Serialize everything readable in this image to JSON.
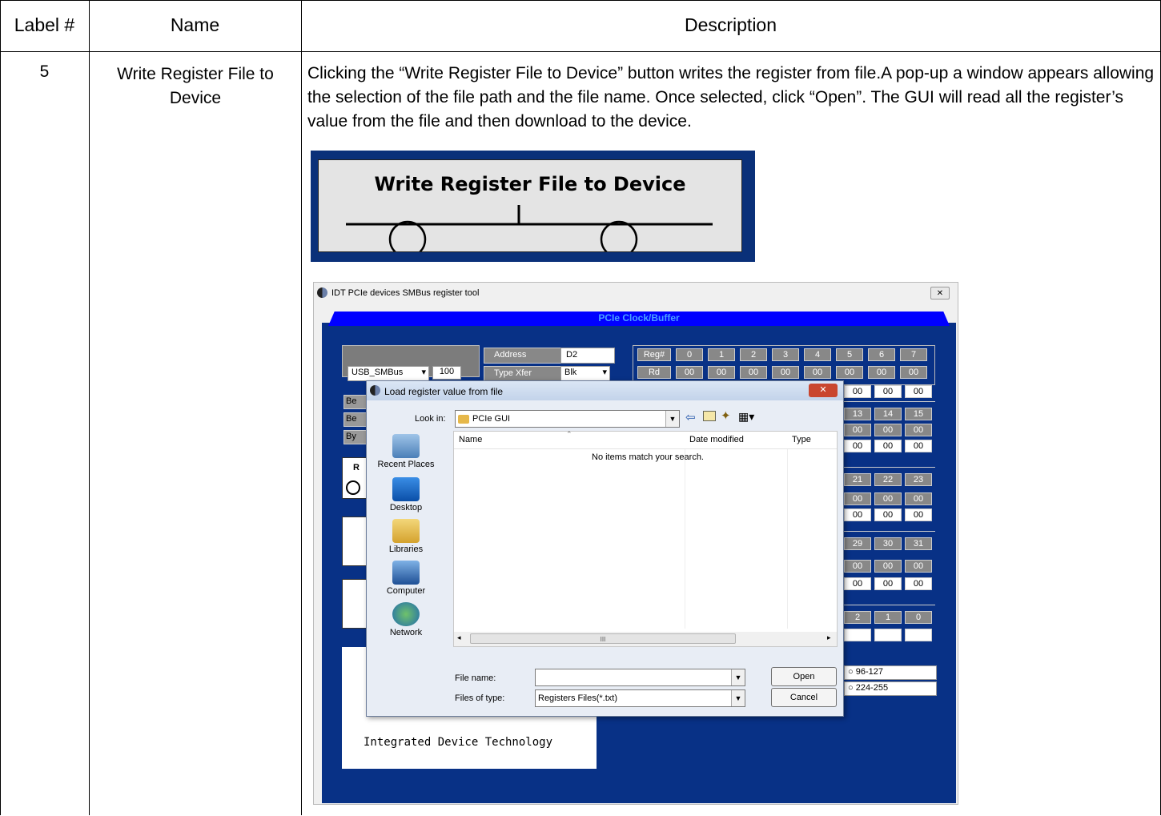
{
  "table": {
    "headers": [
      "Label #",
      "Name",
      "Description"
    ],
    "row": {
      "label": "5",
      "name": "Write Register File to Device",
      "description": "Clicking the “Write Register File to Device” button writes the register from file.A pop-up a window appears allowing the selection of the file path and the file name. Once selected, click “Open”. The GUI will read all the register’s value from the file and then download to the device."
    }
  },
  "banner": {
    "title": "Write  Register File to Device"
  },
  "app": {
    "title": "IDT PCIe devices SMBus register tool",
    "header": "PCIe Clock/Buffer",
    "interface_value": "USB_SMBus",
    "speed_value": "100",
    "address_label": "Address",
    "address_value": "D2",
    "typexfer_label": "Type Xfer",
    "typexfer_value": "Blk",
    "reg_header": "Reg#",
    "reg_row_label": "Rd",
    "reg_numbers": [
      "0",
      "1",
      "2",
      "3",
      "4",
      "5",
      "6",
      "7"
    ],
    "reg_value": "00",
    "col_nums": [
      [
        "13",
        "14",
        "15"
      ],
      [
        "21",
        "22",
        "23"
      ],
      [
        "29",
        "30",
        "31"
      ],
      [
        "2",
        "1",
        "0"
      ]
    ],
    "range1": "96-127",
    "range2": "224-255",
    "company": "Integrated Device Technology",
    "side_labels": [
      "Be",
      "Be",
      "By",
      "R"
    ]
  },
  "dialog": {
    "title": "Load register value from file",
    "look_in_label": "Look in:",
    "look_in_value": "PCIe GUI",
    "places": [
      "Recent Places",
      "Desktop",
      "Libraries",
      "Computer",
      "Network"
    ],
    "col_name": "Name",
    "col_date": "Date modified",
    "col_type": "Type",
    "empty_message": "No items match your search.",
    "scroll_glyph": "III",
    "file_name_label": "File name:",
    "file_name_value": "",
    "files_type_label": "Files of type:",
    "files_type_value": "Registers Files(*.txt)",
    "open_label": "Open",
    "cancel_label": "Cancel"
  }
}
